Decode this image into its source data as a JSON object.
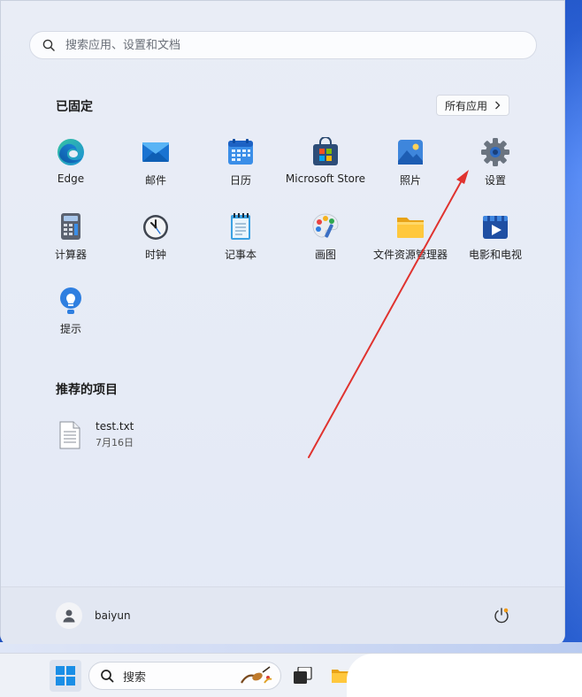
{
  "search": {
    "placeholder": "搜索应用、设置和文档"
  },
  "pinned": {
    "title": "已固定",
    "all_apps_label": "所有应用",
    "apps": [
      {
        "label": "Edge",
        "icon": "edge-icon"
      },
      {
        "label": "邮件",
        "icon": "mail-icon"
      },
      {
        "label": "日历",
        "icon": "calendar-icon"
      },
      {
        "label": "Microsoft Store",
        "icon": "store-icon"
      },
      {
        "label": "照片",
        "icon": "photos-icon"
      },
      {
        "label": "设置",
        "icon": "settings-gear-icon"
      },
      {
        "label": "计算器",
        "icon": "calculator-icon"
      },
      {
        "label": "时钟",
        "icon": "clock-icon"
      },
      {
        "label": "记事本",
        "icon": "notepad-icon"
      },
      {
        "label": "画图",
        "icon": "paint-palette-icon"
      },
      {
        "label": "文件资源管理器",
        "icon": "file-explorer-icon"
      },
      {
        "label": "电影和电视",
        "icon": "movies-tv-icon"
      },
      {
        "label": "提示",
        "icon": "tips-lightbulb-icon"
      }
    ]
  },
  "recommended": {
    "title": "推荐的项目",
    "items": [
      {
        "name": "test.txt",
        "date": "7月16日",
        "icon": "text-file-icon"
      }
    ]
  },
  "user": {
    "name": "baiyun"
  },
  "taskbar": {
    "search_label": "搜索"
  },
  "colors": {
    "accent": "#0067c0",
    "annotation_arrow": "#e0332f"
  }
}
